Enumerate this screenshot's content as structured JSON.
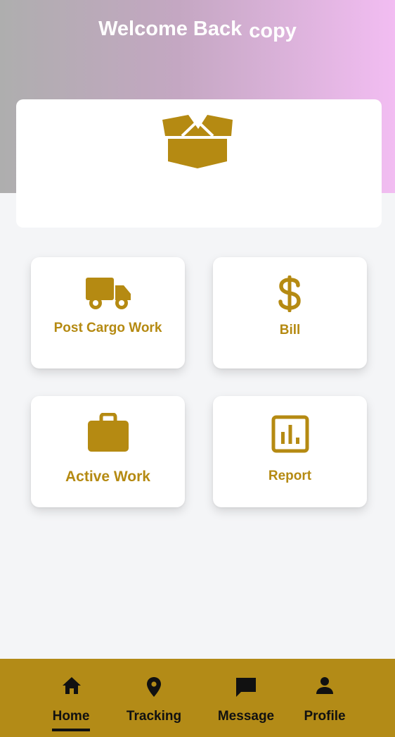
{
  "header": {
    "title_part1": "Welcome Back",
    "title_part2": "copy"
  },
  "banner": {
    "icon": "open-box-icon"
  },
  "tiles": [
    {
      "label": "Post Cargo Work",
      "icon": "truck-icon"
    },
    {
      "label": "Bill",
      "icon": "dollar-icon"
    },
    {
      "label": "Active Work",
      "icon": "briefcase-icon"
    },
    {
      "label": "Report",
      "icon": "report-chart-icon"
    }
  ],
  "nav": {
    "items": [
      {
        "label": "Home",
        "icon": "home-icon",
        "active": true
      },
      {
        "label": "Tracking",
        "icon": "location-pin-icon",
        "active": false
      },
      {
        "label": "Message",
        "icon": "message-icon",
        "active": false
      },
      {
        "label": "Profile",
        "icon": "person-icon",
        "active": false
      }
    ]
  },
  "colors": {
    "accent": "#b58a12",
    "nav_background": "#b38b17",
    "page_background": "#f4f5f7",
    "header_gradient_start": "#aeaeae",
    "header_gradient_end": "#f2bdf2"
  }
}
